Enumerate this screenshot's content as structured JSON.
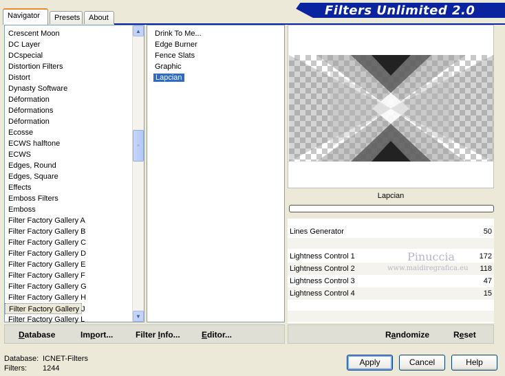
{
  "app": {
    "title": "Filters Unlimited 2.0"
  },
  "tabs": [
    {
      "label": "Navigator"
    },
    {
      "label": "Presets"
    },
    {
      "label": "About"
    }
  ],
  "categories": {
    "items": [
      "Crescent Moon",
      "DC Layer",
      "DCspecial",
      "Distortion Filters",
      "Distort",
      "Dynasty Software",
      "Déformation",
      "Déformations",
      "Déformation",
      "Ecosse",
      "ECWS halftone",
      "ECWS",
      "Edges, Round",
      "Edges, Square",
      "Effects",
      "Emboss Filters",
      "Emboss",
      "Filter Factory Gallery A",
      "Filter Factory Gallery B",
      "Filter Factory Gallery C",
      "Filter Factory Gallery D",
      "Filter Factory Gallery E",
      "Filter Factory Gallery F",
      "Filter Factory Gallery G",
      "Filter Factory Gallery H",
      "Filter Factory Gallery J",
      "Filter Factory Gallery L"
    ],
    "selected": "Filter Factory Gallery J"
  },
  "filters": {
    "items": [
      "Drink To Me...",
      "Edge Burner",
      "Fence Slats",
      "Graphic",
      "Lapcian"
    ],
    "selected": "Lapcian"
  },
  "preview": {
    "filter_name": "Lapcian"
  },
  "params": [
    {
      "label": "Lines Generator",
      "value": "50"
    },
    {
      "label": "Lightness Control 1",
      "value": "172"
    },
    {
      "label": "Lightness Control 2",
      "value": "118"
    },
    {
      "label": "Lightness Control 3",
      "value": "47"
    },
    {
      "label": "Lightness Control 4",
      "value": "15"
    }
  ],
  "watermark": {
    "name": "Pinuccia",
    "site": "www.maidiregrafica.eu"
  },
  "toolbar_left": {
    "database_u": "D",
    "database_rest": "atabase",
    "import_pre": "Im",
    "import_u": "p",
    "import_rest": "ort...",
    "filterinfo_pre": "Filter ",
    "filterinfo_u": "I",
    "filterinfo_rest": "nfo...",
    "editor_u": "E",
    "editor_rest": "ditor..."
  },
  "toolbar_right": {
    "randomize_pre": "R",
    "randomize_u": "a",
    "randomize_rest": "ndomize",
    "reset_pre": "R",
    "reset_u": "e",
    "reset_rest": "set"
  },
  "status": {
    "database_label": "Database:",
    "database_value": "ICNET-Filters",
    "filters_label": "Filters:",
    "filters_value": "1244"
  },
  "buttons": {
    "apply": "Apply",
    "cancel": "Cancel",
    "help": "Help"
  },
  "colors": {
    "banner": "#0a24a0",
    "selection": "#316ac5",
    "window": "#ece9d8"
  }
}
